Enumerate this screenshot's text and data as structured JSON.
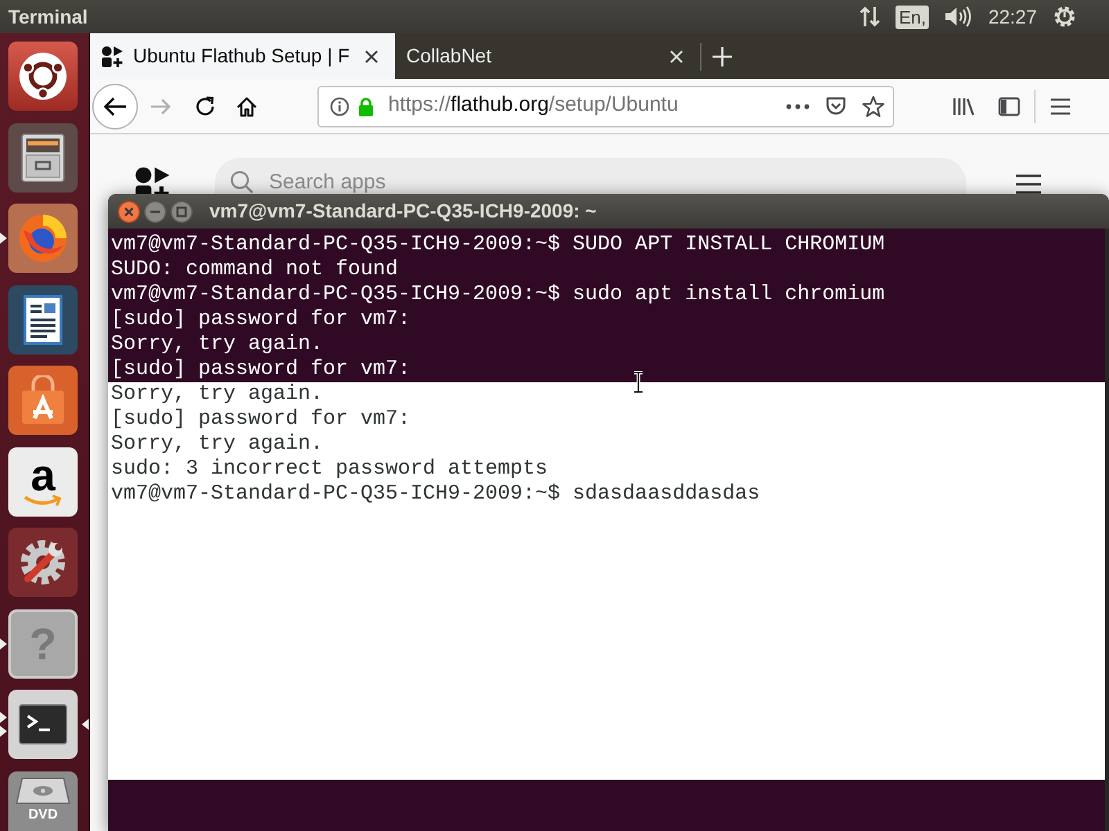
{
  "top_panel": {
    "title": "Terminal",
    "keyboard_layout": "En,",
    "clock": "22:27"
  },
  "launcher": {
    "items": [
      {
        "kind": "ring-logo",
        "running": false,
        "second_window": false,
        "focused": false
      },
      {
        "kind": "file-cabinet",
        "running": false,
        "second_window": false,
        "focused": false
      },
      {
        "kind": "fox-globe",
        "running": true,
        "second_window": false,
        "focused": false
      },
      {
        "kind": "document",
        "running": false,
        "second_window": false,
        "focused": false
      },
      {
        "kind": "shopping-bag",
        "running": false,
        "second_window": false,
        "focused": false
      },
      {
        "kind": "letter-tile",
        "label": "a",
        "running": false,
        "second_window": false,
        "focused": false
      },
      {
        "kind": "gear-wrench",
        "running": false,
        "second_window": false,
        "focused": false
      },
      {
        "kind": "question-tile",
        "label": "?",
        "running": true,
        "second_window": false,
        "focused": false
      },
      {
        "kind": "terminal",
        "running": true,
        "second_window": true,
        "focused": true
      },
      {
        "kind": "disc-drive",
        "label": "DVD",
        "running": false,
        "second_window": false,
        "focused": false
      }
    ]
  },
  "browser": {
    "tabs": [
      {
        "title": "Ubuntu Flathub Setup | F",
        "favicon": true,
        "selected": true
      },
      {
        "title": "CollabNet",
        "favicon": false,
        "selected": false
      }
    ],
    "toolbar": {
      "back_disabled": false,
      "forward_disabled": true,
      "url": {
        "scheme": "https://",
        "host": "flathub.org",
        "path": "/setup/Ubuntu"
      }
    },
    "page": {
      "search": {
        "placeholder": "Search apps"
      }
    }
  },
  "terminal": {
    "title": "vm7@vm7-Standard-PC-Q35-ICH9-2009: ~",
    "regions": [
      {
        "kind": "dark",
        "lines": [
          "vm7@vm7-Standard-PC-Q35-ICH9-2009:~$ SUDO APT INSTALL CHROMIUM",
          "SUDO: command not found",
          "vm7@vm7-Standard-PC-Q35-ICH9-2009:~$ sudo apt install chromium",
          "[sudo] password for vm7:",
          "Sorry, try again.",
          "[sudo] password for vm7:"
        ]
      },
      {
        "kind": "light",
        "lines": [
          "Sorry, try again.",
          "[sudo] password for vm7:",
          "Sorry, try again.",
          "sudo: 3 incorrect password attempts",
          "vm7@vm7-Standard-PC-Q35-ICH9-2009:~$ sdasdaasddasdas"
        ]
      }
    ]
  }
}
